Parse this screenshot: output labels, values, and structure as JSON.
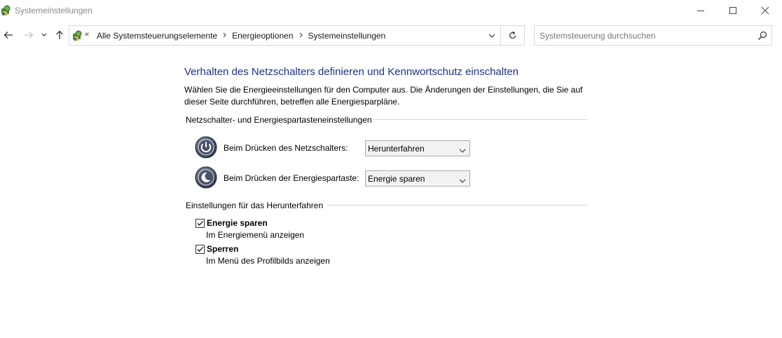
{
  "window": {
    "title": "Systemeinstellungen"
  },
  "navigation": {
    "breadcrumb_prefix": "«",
    "breadcrumbs": [
      "Alle Systemsteuerungselemente",
      "Energieoptionen",
      "Systemeinstellungen"
    ],
    "search_placeholder": "Systemsteuerung durchsuchen"
  },
  "main": {
    "heading": "Verhalten des Netzschalters definieren und Kennwortschutz einschalten",
    "description": "Wählen Sie die Energieeinstellungen für den Computer aus. Die Änderungen der Einstellungen, die Sie auf dieser Seite durchführen, betreffen alle Energiesparpläne.",
    "power_group": {
      "title": "Netzschalter- und Energiespartasteneinstellungen",
      "settings": [
        {
          "label": "Beim Drücken des Netzschalters:",
          "value": "Herunterfahren",
          "icon": "power-button-icon"
        },
        {
          "label": "Beim Drücken der Energiespartaste:",
          "value": "Energie sparen",
          "icon": "sleep-button-icon"
        }
      ]
    },
    "shutdown_group": {
      "title": "Einstellungen für das Herunterfahren",
      "options": [
        {
          "title": "Energie sparen",
          "subtitle": "Im Energiemenü anzeigen",
          "checked": true
        },
        {
          "title": "Sperren",
          "subtitle": "Im Menü des Profilbilds anzeigen",
          "checked": true
        }
      ]
    }
  }
}
